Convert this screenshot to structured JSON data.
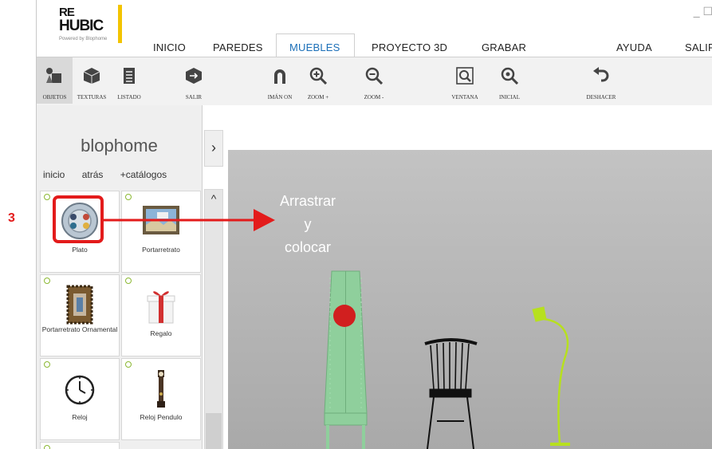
{
  "logo": {
    "line1": "RE",
    "line2": "HUBIC",
    "tagline": "Powered by Blophome"
  },
  "window_controls": "_ ☐",
  "nav": [
    "INICIO",
    "PAREDES",
    "MUEBLES",
    "PROYECTO 3D",
    "GRABAR",
    "AYUDA",
    "SALIR"
  ],
  "nav_active": "MUEBLES",
  "toolbar": {
    "objetos": "OBJETOS",
    "texturas": "TEXTURAS",
    "listado": "LISTADO",
    "salir": "SALIR",
    "iman": "IMÁN ON",
    "zoom_in": "ZOOM +",
    "zoom_out": "ZOOM -",
    "ventana": "VENTANA",
    "inicial": "INICIAL",
    "deshacer": "DESHACER"
  },
  "sidebar": {
    "brand": "blophome",
    "links": [
      "inicio",
      "atrás",
      "+catálogos"
    ],
    "items": [
      "Plato",
      "Portarretrato",
      "Portarretrato Ornamental",
      "Regalo",
      "Reloj",
      "Reloj Pendulo"
    ]
  },
  "annotation": {
    "step": "3",
    "text_l1": "Arrastrar",
    "text_l2": "y",
    "text_l3": "colocar",
    "color": "#e31b1b"
  },
  "colors": {
    "accent_yellow": "#f3c400",
    "highlight_red": "#e31b1b",
    "lamp": "#b7e01e",
    "cabinet": "#8fcf9c"
  }
}
